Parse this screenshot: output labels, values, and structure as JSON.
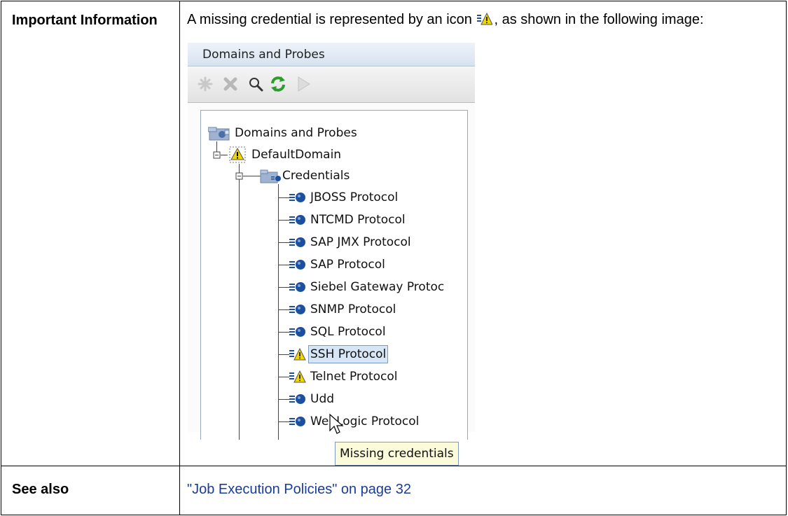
{
  "table": {
    "rows": [
      {
        "label": "Important Information",
        "text_before_icon": "A missing credential is represented by an icon",
        "inline_icon": "missing-credential-icon",
        "text_after_icon": ", as shown in the following image:"
      },
      {
        "label": "See also",
        "link_text": "\"Job Execution Policies\" on page 32"
      }
    ]
  },
  "screenshot": {
    "title": "Domains and Probes",
    "toolbar_icons": [
      "new-icon",
      "delete-icon",
      "search-icon",
      "refresh-icon",
      "run-icon"
    ],
    "tree": {
      "root": {
        "label": "Domains and Probes",
        "icon": "domains-probes-icon"
      },
      "domain": {
        "label": "DefaultDomain",
        "icon": "domain-warning-icon"
      },
      "folder": {
        "label": "Credentials",
        "icon": "credentials-folder-icon"
      },
      "protocols": [
        {
          "label": "JBOSS Protocol",
          "icon": "protocol-icon",
          "missing": false,
          "selected": false
        },
        {
          "label": "NTCMD Protocol",
          "icon": "protocol-icon",
          "missing": false,
          "selected": false
        },
        {
          "label": "SAP JMX Protocol",
          "icon": "protocol-icon",
          "missing": false,
          "selected": false
        },
        {
          "label": "SAP Protocol",
          "icon": "protocol-icon",
          "missing": false,
          "selected": false
        },
        {
          "label": "Siebel Gateway Protoc",
          "icon": "protocol-icon",
          "missing": false,
          "selected": false
        },
        {
          "label": "SNMP Protocol",
          "icon": "protocol-icon",
          "missing": false,
          "selected": false
        },
        {
          "label": "SQL Protocol",
          "icon": "protocol-icon",
          "missing": false,
          "selected": false
        },
        {
          "label": "SSH Protocol",
          "icon": "missing-credential-icon",
          "missing": true,
          "selected": true
        },
        {
          "label": "Telnet Protocol",
          "icon": "missing-credential-icon",
          "missing": true,
          "selected": false
        },
        {
          "label": "Udd",
          "icon": "protocol-icon",
          "missing": false,
          "selected": false
        },
        {
          "label": "WebLogic Protocol",
          "icon": "protocol-icon",
          "missing": false,
          "selected": false
        }
      ]
    },
    "tooltip": "Missing credentials"
  },
  "colors": {
    "link": "#1a3c99",
    "warning_yellow": "#f2d600",
    "protocol_blue": "#1d4fa0",
    "refresh_green": "#2e9c2a"
  }
}
